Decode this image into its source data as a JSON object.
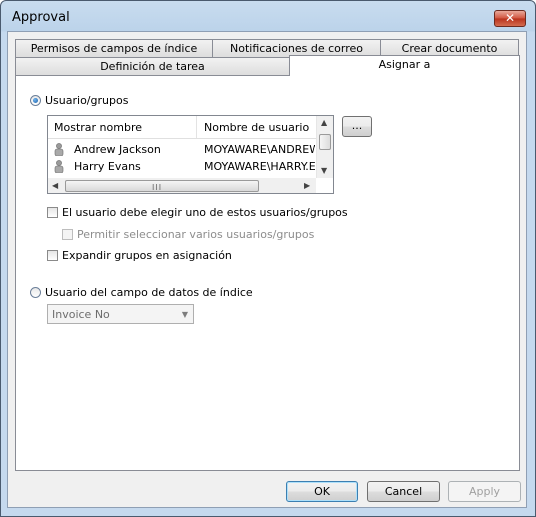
{
  "window": {
    "title": "Approval",
    "close_glyph": "✕"
  },
  "tabs": {
    "row_back": [
      "Permisos de campos de índice",
      "Notificaciones de correo",
      "Crear documento"
    ],
    "row_front": [
      "Definición de tarea",
      "Asignar a"
    ],
    "active": "Asignar a"
  },
  "assign": {
    "radio_users_label": "Usuario/grupos",
    "radio_users_checked": true,
    "list": {
      "columns": [
        "Mostrar nombre",
        "Nombre de usuario"
      ],
      "rows": [
        {
          "display_name": "Andrew Jackson",
          "user_name": "MOYAWARE\\ANDREW.JACKSON",
          "icon": "user-icon"
        },
        {
          "display_name": "Harry Evans",
          "user_name": "MOYAWARE\\HARRY.EVANS",
          "icon": "user-icon"
        }
      ],
      "scroll_grip": "III"
    },
    "browse_label": "...",
    "cb_must_choose_label": "El usuario debe elegir uno de estos usuarios/grupos",
    "cb_must_choose_checked": false,
    "cb_multi_select_label": "Permitir seleccionar varios usuarios/grupos",
    "cb_multi_select_checked": false,
    "cb_expand_groups_label": "Expandir grupos en asignación",
    "cb_expand_groups_checked": false,
    "radio_field_label": "Usuario del campo de datos de índice",
    "radio_field_checked": false,
    "field_select_value": "Invoice No"
  },
  "buttons": {
    "ok": "OK",
    "cancel": "Cancel",
    "apply": "Apply"
  },
  "colors": {
    "title_bar": "#bcd3ea",
    "close_button": "#c8412a",
    "dialog_bg": "#f0f0f0",
    "default_button_border": "#3c7fb1"
  }
}
